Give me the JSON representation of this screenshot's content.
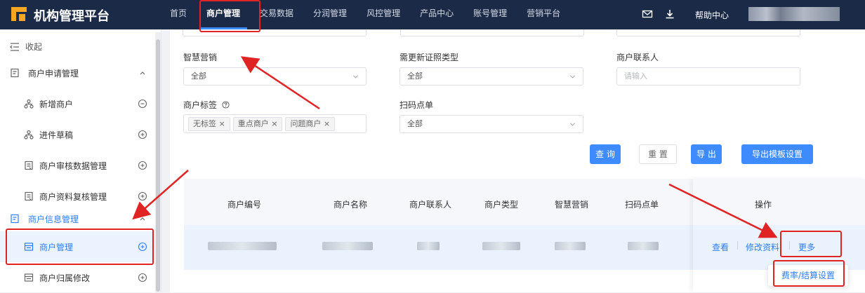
{
  "app": {
    "title": "机构管理平台"
  },
  "nav": [
    {
      "label": "首页"
    },
    {
      "label": "商户管理",
      "active": true
    },
    {
      "label": "交易数据"
    },
    {
      "label": "分润管理"
    },
    {
      "label": "风控管理"
    },
    {
      "label": "产品中心"
    },
    {
      "label": "账号管理"
    },
    {
      "label": "营销平台"
    }
  ],
  "header": {
    "help": "帮助中心",
    "icons": [
      "mail-icon",
      "download-icon"
    ]
  },
  "sidebar": {
    "collapse_label": "收起",
    "items": [
      {
        "label": "商户申请管理",
        "type": "group",
        "icon": "form-icon",
        "tail": "chevron-up"
      },
      {
        "label": "新增商户",
        "type": "sub",
        "icon": "org-icon",
        "tail": "minus-circle"
      },
      {
        "label": "进件草稿",
        "type": "sub",
        "icon": "org-icon",
        "tail": "plus-circle"
      },
      {
        "label": "商户审核数据管理",
        "type": "sub",
        "icon": "doc-icon",
        "tail": "plus-circle"
      },
      {
        "label": "商户资料复核管理",
        "type": "sub",
        "icon": "doc-icon",
        "tail": "plus-circle"
      },
      {
        "label": "商户信息管理",
        "type": "group",
        "icon": "form-icon",
        "tail": "chevron-up"
      },
      {
        "label": "商户管理",
        "type": "sub",
        "icon": "list-icon",
        "tail": "plus-circle"
      },
      {
        "label": "商户归属修改",
        "type": "sub",
        "icon": "list-icon",
        "tail": "plus-circle"
      }
    ]
  },
  "filters": {
    "smart_marketing": {
      "label": "智慧营销",
      "value": "全部"
    },
    "cert_type": {
      "label": "需更新证照类型",
      "value": "全部"
    },
    "contact": {
      "label": "商户联系人",
      "placeholder": "请输入"
    },
    "tags": {
      "label": "商户标签",
      "values": [
        "无标签",
        "重点商户",
        "问题商户"
      ]
    },
    "scan_order": {
      "label": "扫码点单",
      "value": "全部"
    }
  },
  "buttons": {
    "query": "查 询",
    "reset": "重 置",
    "export": "导 出",
    "export_template": "导出模板设置"
  },
  "table": {
    "columns": [
      "商户编号",
      "商户名称",
      "商户联系人",
      "商户类型",
      "智慧营销",
      "扫码点单",
      "操作"
    ]
  },
  "ops": {
    "view": "查看",
    "edit": "修改资料",
    "more": "更多",
    "menu_item": "费率/结算设置"
  },
  "colors": {
    "accent": "#3d8bfd",
    "topbar": "#1b2a47",
    "highlight": "#e02424"
  }
}
